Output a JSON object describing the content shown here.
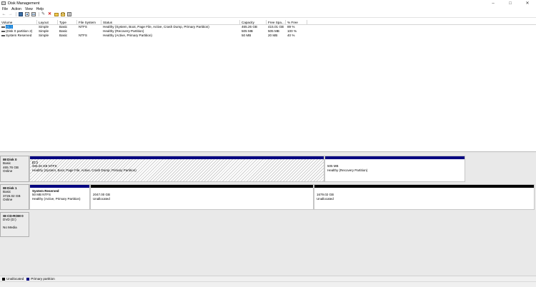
{
  "window": {
    "title": "Disk Management"
  },
  "menu": [
    "File",
    "Action",
    "View",
    "Help"
  ],
  "volume_table": {
    "headers": [
      "Volume",
      "Layout",
      "Type",
      "File System",
      "Status",
      "Capacity",
      "Free Spa...",
      "% Free"
    ],
    "rows": [
      {
        "volume": "(C:)",
        "layout": "Simple",
        "type": "Basic",
        "fs": "NTFS",
        "status": "Healthy (System, Boot, Page File, Active, Crash Dump, Primary Partition)",
        "capacity": "465.26 GB",
        "free": "415.01 GB",
        "pct": "89 %"
      },
      {
        "volume": "(Disk 0 partition 2)",
        "layout": "Simple",
        "type": "Basic",
        "fs": "",
        "status": "Healthy (Recovery Partition)",
        "capacity": "505 MB",
        "free": "505 MB",
        "pct": "100 %"
      },
      {
        "volume": "System Reserved",
        "layout": "Simple",
        "type": "Basic",
        "fs": "NTFS",
        "status": "Healthy (Active, Primary Partition)",
        "capacity": "50 MB",
        "free": "20 MB",
        "pct": "40 %"
      }
    ]
  },
  "disks": {
    "disk0": {
      "name": "Disk 0",
      "kind": "Basic",
      "size": "465.76 GB",
      "state": "Online",
      "p1": {
        "label": "(C:)",
        "size": "465.26 GB NTFS",
        "status": "Healthy (System, Boot, Page File, Active, Crash Dump, Primary Partition)"
      },
      "p2": {
        "size": "505 MB",
        "status": "Healthy (Recovery Partition)"
      }
    },
    "disk1": {
      "name": "Disk 1",
      "kind": "Basic",
      "size": "3726.02 GB",
      "state": "Online",
      "p1": {
        "label": "System Reserved",
        "size": "50 MB NTFS",
        "status": "Healthy (Active, Primary Partition)"
      },
      "p2": {
        "size": "2047.00 GB",
        "status": "Unallocated"
      },
      "p3": {
        "size": "1679.02 GB",
        "status": "Unallocated"
      }
    },
    "cdrom0": {
      "name": "CD-ROM 0",
      "kind": "DVD (D:)",
      "state": "No Media"
    }
  },
  "legend": {
    "unallocated": "Unallocated",
    "primary": "Primary partition"
  },
  "colors": {
    "primary_bar": "#000080",
    "unallocated_bar": "#000000",
    "selection": "#0078d7"
  },
  "icons": [
    "app-icon",
    "back-icon",
    "forward-icon",
    "properties-icon",
    "help-icon",
    "connect-icon",
    "delete-icon",
    "folder-icon",
    "open-icon",
    "options-icon"
  ]
}
